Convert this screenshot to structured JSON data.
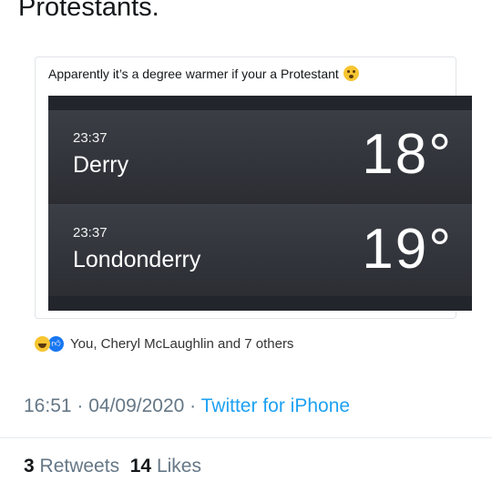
{
  "tweet": {
    "text": "Protestants."
  },
  "quote": {
    "text": "Apparently it’s a degree warmer if your a Protestant",
    "emoji": "thinking-face-emoji",
    "weather": [
      {
        "time": "23:37",
        "city": "Derry",
        "temp": "18°"
      },
      {
        "time": "23:37",
        "city": "Londonderry",
        "temp": "19°"
      }
    ]
  },
  "reactions": {
    "text": "You, Cheryl McLaughlin and 7 others",
    "icons": [
      "haha-emoji",
      "like-icon"
    ]
  },
  "meta": {
    "time": "16:51",
    "separator": " · ",
    "date": "04/09/2020",
    "source": "Twitter for iPhone"
  },
  "stats": {
    "retweets_count": "3",
    "retweets_label": "Retweets",
    "likes_count": "14",
    "likes_label": "Likes"
  },
  "colors": {
    "link": "#1da1f2",
    "muted": "#657786",
    "text": "#14171a",
    "weather_bg": "#2e3036"
  }
}
